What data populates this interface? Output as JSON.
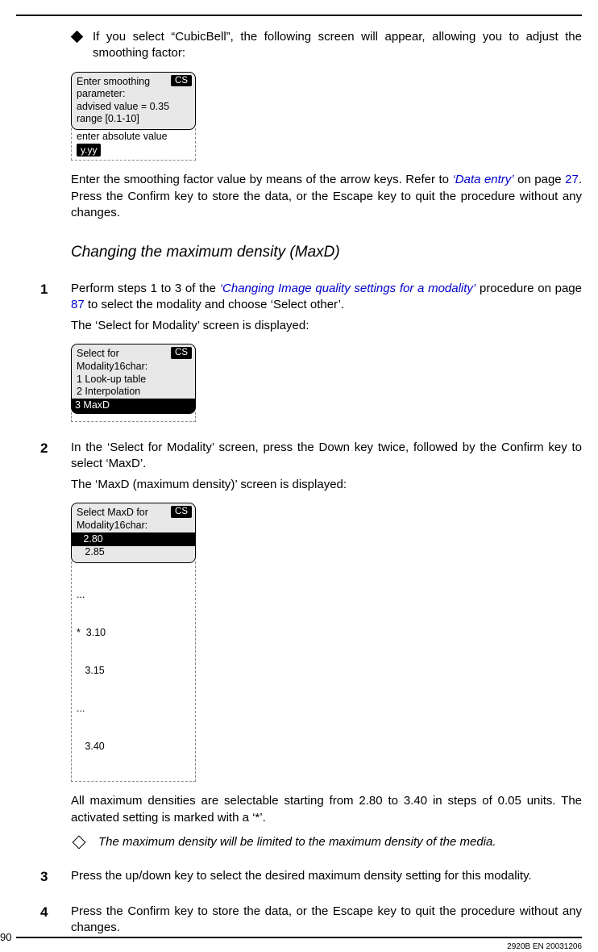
{
  "page_number": "90",
  "doc_code": "2920B EN 20031206",
  "bullet1_text": "If you select “CubicBell”, the following screen will appear, allowing you to adjust the smoothing factor:",
  "lcd1": {
    "cs": "CS",
    "l1": "Enter smoothing",
    "l2": "parameter:",
    "l3": "advised value = 0.35",
    "l4": "range [0.1-10]",
    "below_label": "enter absolute value",
    "chip": "y.yy"
  },
  "para_after_lcd1_a": "Enter the smoothing factor value by means of the arrow keys. Refer to ",
  "link_data_entry": "‘Data entry’",
  "para_after_lcd1_b": " on page ",
  "page27": "27",
  "para_after_lcd1_c": ". Press the Confirm key to store the data, or the Escape key to quit the procedure without any changes.",
  "subheading": "Changing the maximum density (MaxD)",
  "step1_a": "Perform steps 1 to 3 of the ",
  "step1_link": "‘Changing Image quality settings for a modality’",
  "step1_b": " procedure on page ",
  "page87": "87",
  "step1_c": " to select the modality and choose ‘Select other’.",
  "step1_after": "The ‘Select for Modality’ screen is displayed:",
  "lcd2": {
    "cs": "CS",
    "l1": "Select for",
    "l2": "Modality16char:",
    "l3": "1 Look-up table",
    "l4": "2 Interpolation",
    "sel": "3 MaxD"
  },
  "step2_a": "In the ‘Select for Modality’ screen, press the Down key twice, followed by the Confirm key to select ‘MaxD’.",
  "step2_after": "The ‘MaxD (maximum density)’ screen is displayed:",
  "lcd3": {
    "cs": "CS",
    "l1": "Select MaxD for",
    "l2": "Modality16char:",
    "sel": "   2.80",
    "l4": "   2.85",
    "b1": "...",
    "b2": "*  3.10",
    "b3": "   3.15",
    "b4": "...",
    "b5": "   3.40"
  },
  "para_after_lcd3": "All maximum densities are selectable starting from 2.80 to 3.40 in steps of 0.05 units. The activated setting is marked with a ‘*’.",
  "note_text": "The maximum density will be limited to the maximum density of the media.",
  "step3": "Press the up/down key to select the desired maximum density setting for this modality.",
  "step4": "Press the Confirm key to store the data, or the Escape key to quit the procedure without any changes.",
  "nums": {
    "n1": "1",
    "n2": "2",
    "n3": "3",
    "n4": "4"
  }
}
